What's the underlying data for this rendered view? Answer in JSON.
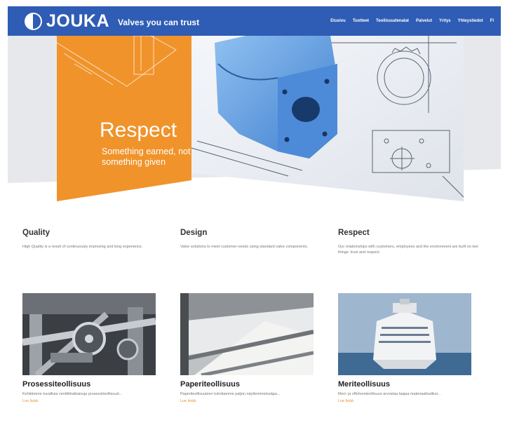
{
  "header": {
    "brand": "JOUKA",
    "tagline": "Valves you can trust",
    "nav": [
      "Etusivu",
      "Tuotteet",
      "Teollisuudenalat",
      "Palvelut",
      "Yritys",
      "Yhteystiedot",
      "FI"
    ]
  },
  "hero": {
    "title": "Respect",
    "subtitle": "Something earned, not something given"
  },
  "features": [
    {
      "title": "Quality",
      "text": "High Quality is a result of continuously improving and long experience."
    },
    {
      "title": "Design",
      "text": "Valve solutions to meet customer needs using standard valve components."
    },
    {
      "title": "Respect",
      "text": "Our relationships with customers, employees and the environment are built on two things: trust and respect."
    }
  ],
  "industries": [
    {
      "title": "Prosessiteollisuus",
      "text": "Kehitämme tuvallisia venttiiliratkaisuja prosessiteollisuud...",
      "link": "Lue lisää"
    },
    {
      "title": "Paperiteollisuus",
      "text": "Paperiteollisuuteen toimitamme paljon näyttemmetssäpa...",
      "link": "Lue lisää"
    },
    {
      "title": "Meriteollisuus",
      "text": "Meri- ja offshoreteollisuus arvostaa laajaa materiaalivalikoi...",
      "link": "Lue lisää"
    }
  ],
  "colors": {
    "navbar": "#2f5cb4",
    "hero_orange": "#f0932b",
    "link": "#e7922a"
  }
}
